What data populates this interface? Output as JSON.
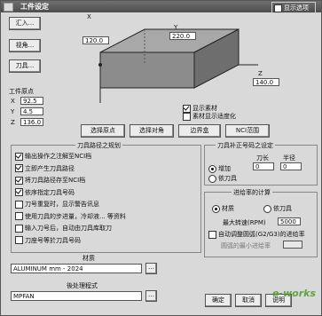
{
  "window": {
    "title": "工件设定",
    "corner_check_label": "显示选项"
  },
  "buttons": {
    "bring_in": "汇入...",
    "view": "视角...",
    "tool": "刀具...",
    "select_origin": "选择原点",
    "select_corner": "选择对角",
    "bounding_box": "边界盒",
    "nci_range": "NCI范围",
    "ok": "确定",
    "cancel": "取消",
    "help": "说明"
  },
  "dims": {
    "x": "120.0",
    "y": "220.0",
    "z": "140.0",
    "x_axis": "X",
    "y_axis": "Y",
    "z_axis": "Z"
  },
  "origin": {
    "title": "工件原点",
    "x_label": "X",
    "x_val": "92.5",
    "y_label": "Y",
    "y_val": "4.5",
    "z_label": "Z",
    "z_val": "136.0"
  },
  "display": {
    "show_material": "显示素材",
    "show_material_fit": "素材显示适度化"
  },
  "toolpath": {
    "title": "刀具路径之规划",
    "items": [
      {
        "label": "输出操作之注解至NCI档",
        "checked": true
      },
      {
        "label": "立即产生刀具路径",
        "checked": true
      },
      {
        "label": "将刀具路径存至NCI档",
        "checked": true
      },
      {
        "label": "依序指定刀具号码",
        "checked": true
      },
      {
        "label": "刀号重复时，显示警告讯息",
        "checked": false
      },
      {
        "label": "使用刀具的步进量，冷却液... 等资料",
        "checked": false
      },
      {
        "label": "输入刀号后，自动由刀具库取刀",
        "checked": false
      },
      {
        "label": "刀座号等於刀具号码",
        "checked": false
      }
    ]
  },
  "comp": {
    "title": "刀具补正号码之设定",
    "dia_label": "刀长",
    "radius_label": "半径",
    "dia_val": "0",
    "radius_val": "0",
    "add": "增加",
    "follow": "依刀具"
  },
  "feed": {
    "title": "进给率的计算",
    "material": "材质",
    "tool": "依刀具",
    "max_spindle_label": "最大转速(RPM)",
    "max_spindle_val": "5000",
    "auto_adjust": "自动调整圆弧(G2/G3)的进给率",
    "min_arc_label": "圆弧的最小进给率"
  },
  "material": {
    "title": "材质",
    "value": "ALUMINUM mm - 2024"
  },
  "post": {
    "title": "後处理程式",
    "value": "MPFAN"
  },
  "watermark": "e-works"
}
